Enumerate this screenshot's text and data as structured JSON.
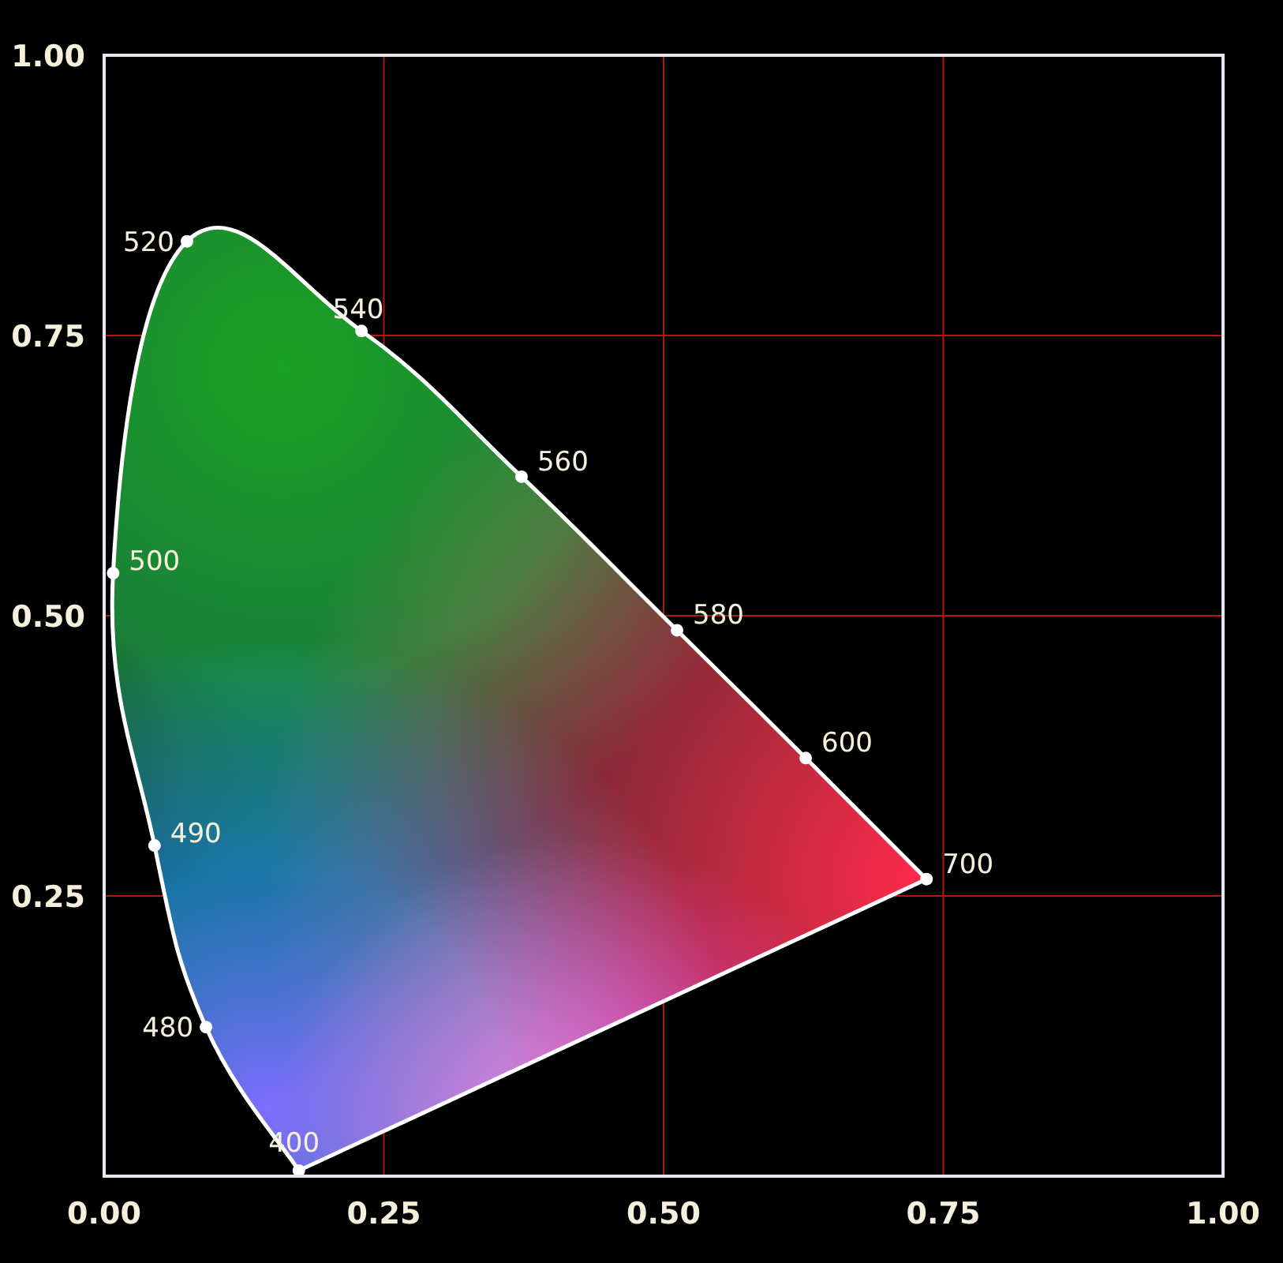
{
  "chart_data": {
    "type": "scatter",
    "x": [
      0.174,
      0.091,
      0.045,
      0.008,
      0.074,
      0.23,
      0.373,
      0.512,
      0.627,
      0.735
    ],
    "series": [
      {
        "color": "#ffffff",
        "values": [
          0.005,
          0.133,
          0.295,
          0.538,
          0.834,
          0.754,
          0.624,
          0.487,
          0.373,
          0.265
        ]
      }
    ],
    "grid": true,
    "xlim": [
      0,
      1
    ],
    "ylim": [
      0,
      1
    ],
    "xticks": [
      {
        "value": 0,
        "label": "0.00"
      },
      {
        "value": 0.25,
        "label": "0.25"
      },
      {
        "value": 0.5,
        "label": "0.50"
      },
      {
        "value": 0.75,
        "label": "0.75"
      },
      {
        "value": 1,
        "label": "1.00"
      }
    ],
    "yticks": [
      {
        "value": 0.25,
        "label": "0.25"
      },
      {
        "value": 0.5,
        "label": "0.50"
      },
      {
        "value": 0.75,
        "label": "0.75"
      },
      {
        "value": 1,
        "label": "1.00"
      }
    ],
    "annotations": [
      {
        "x": 0.174,
        "y": 0.005,
        "text": "400"
      },
      {
        "x": 0.091,
        "y": 0.133,
        "text": "480"
      },
      {
        "x": 0.045,
        "y": 0.295,
        "text": "490"
      },
      {
        "x": 0.008,
        "y": 0.538,
        "text": "500"
      },
      {
        "x": 0.074,
        "y": 0.834,
        "text": "520"
      },
      {
        "x": 0.23,
        "y": 0.754,
        "text": "540"
      },
      {
        "x": 0.373,
        "y": 0.624,
        "text": "560"
      },
      {
        "x": 0.512,
        "y": 0.487,
        "text": "580"
      },
      {
        "x": 0.627,
        "y": 0.373,
        "text": "600"
      },
      {
        "x": 0.735,
        "y": 0.265,
        "text": "700"
      }
    ]
  }
}
